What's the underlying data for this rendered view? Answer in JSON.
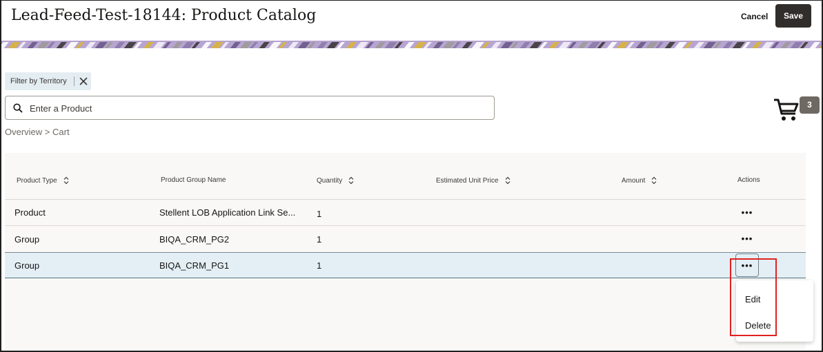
{
  "header": {
    "title": "Lead-Feed-Test-18144: Product Catalog",
    "cancel_label": "Cancel",
    "save_label": "Save"
  },
  "filter": {
    "chip_label": "Filter by Territory",
    "clear_icon": "close-icon"
  },
  "search": {
    "placeholder": "Enter a Product",
    "value": "",
    "icon": "search-icon"
  },
  "cart": {
    "icon": "cart-icon",
    "count": "3"
  },
  "breadcrumb": {
    "text": "Overview > Cart"
  },
  "table": {
    "columns": [
      {
        "label": "Product Type",
        "sortable": true
      },
      {
        "label": "Product Group Name",
        "sortable": false
      },
      {
        "label": "Quantity",
        "sortable": true
      },
      {
        "label": "Estimated Unit Price",
        "sortable": true
      },
      {
        "label": "Amount",
        "sortable": true
      },
      {
        "label": "Actions",
        "sortable": false
      }
    ],
    "rows": [
      {
        "type": "Product",
        "group": "Stellent LOB Application Link Se...",
        "quantity": "1",
        "price": "",
        "amount": "",
        "actions": "•••"
      },
      {
        "type": "Group",
        "group": "BIQA_CRM_PG2",
        "quantity": "1",
        "price": "",
        "amount": "",
        "actions": "•••"
      },
      {
        "type": "Group",
        "group": "BIQA_CRM_PG1",
        "quantity": "1",
        "price": "",
        "amount": "",
        "actions": "•••",
        "selected": true
      }
    ]
  },
  "actions_menu": {
    "items": [
      "Edit",
      "Delete"
    ]
  },
  "colors": {
    "save_button": "#312d2a",
    "selected_row": "#e4eff5",
    "highlight": "#e0201f",
    "badge": "#6f6964"
  }
}
